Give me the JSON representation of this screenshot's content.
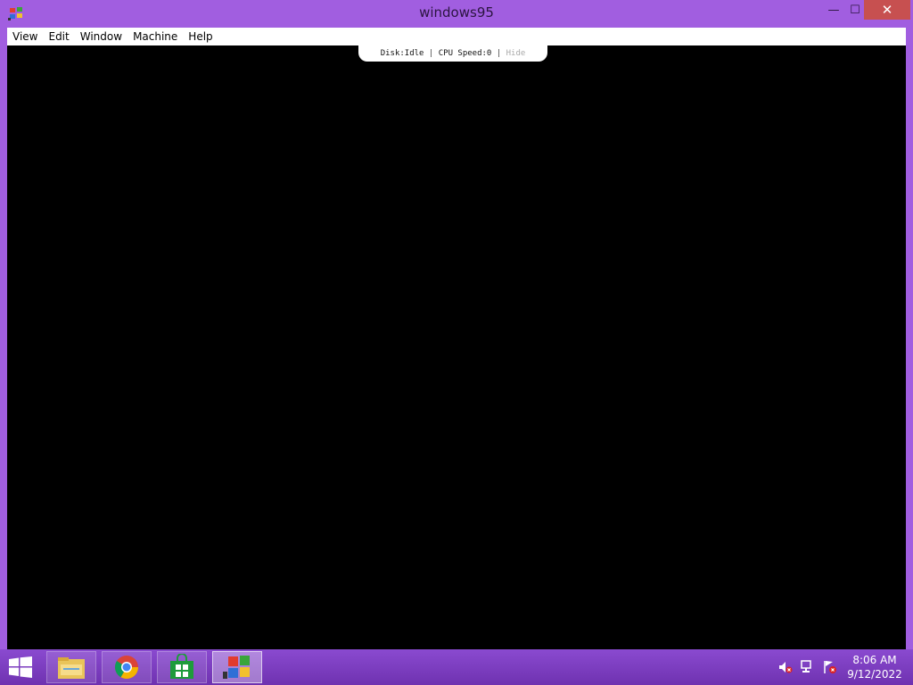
{
  "window": {
    "title": "windows95",
    "menu": [
      "View",
      "Edit",
      "Window",
      "Machine",
      "Help"
    ],
    "controls": {
      "minimize": "—",
      "maximize": "☐",
      "close": "✕"
    }
  },
  "status": {
    "disk_label": "Disk:",
    "disk_value": "Idle",
    "cpu_label": "CPU Speed:",
    "cpu_value": "0",
    "hide_label": "Hide"
  },
  "taskbar": {
    "apps": [
      {
        "name": "file-explorer",
        "icon": "folder-icon"
      },
      {
        "name": "chrome",
        "icon": "chrome-icon"
      },
      {
        "name": "store",
        "icon": "store-icon"
      },
      {
        "name": "windows95",
        "icon": "windows95-icon",
        "active": true
      }
    ],
    "tray": [
      "volume-muted-icon",
      "network-icon",
      "action-center-icon"
    ],
    "clock": {
      "time": "8:06 AM",
      "date": "9/12/2022"
    }
  },
  "colors": {
    "frame": "#a15ee0",
    "taskbar": "#7d3fbf",
    "close_button": "#c75050",
    "viewport": "#000000"
  }
}
